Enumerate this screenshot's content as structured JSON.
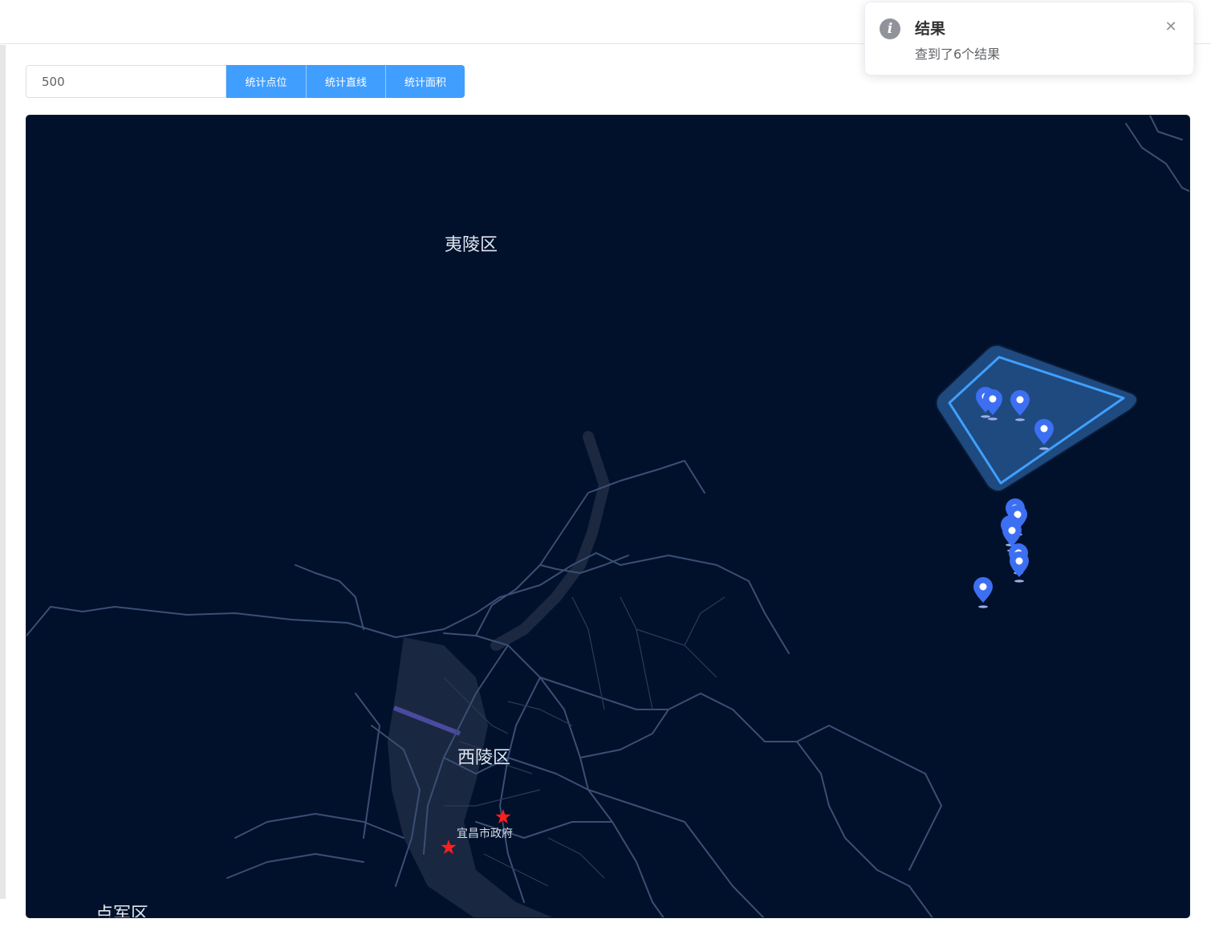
{
  "toolbar": {
    "radius_value": "500",
    "buttons": {
      "stat_points": "统计点位",
      "stat_line": "统计直线",
      "stat_area": "统计面积"
    }
  },
  "notification": {
    "title": "结果",
    "message": "查到了6个结果",
    "icon": "info-icon",
    "close_icon": "close-icon"
  },
  "map": {
    "labels": {
      "district_yiling": "夷陵区",
      "district_xiling": "西陵区",
      "district_dianjun": "点军区",
      "poi_gov": "宜昌市政府"
    },
    "colors": {
      "background": "#01112b",
      "roads": "#3a4f74",
      "river": "#1f2b44",
      "polygon_fill": "#1f4a80",
      "polygon_stroke": "#3fa0ff",
      "marker": "#3d6ff2",
      "star": "#ff1e1e"
    }
  }
}
